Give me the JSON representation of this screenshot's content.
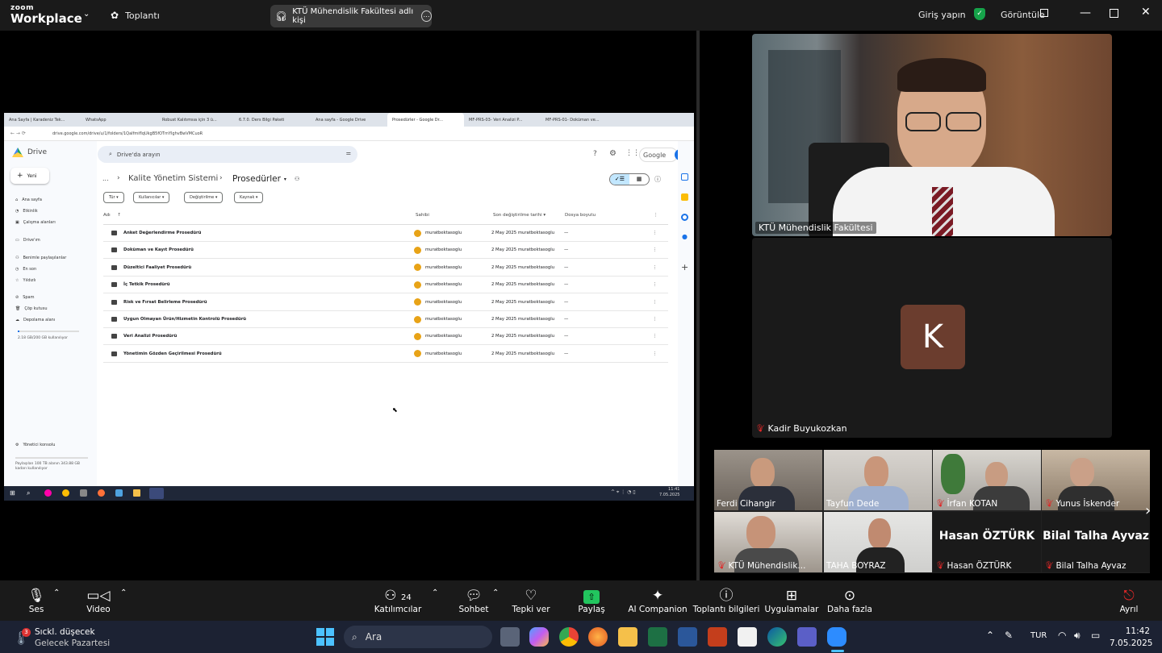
{
  "zoom": {
    "logo_top": "zoom",
    "logo_bottom": "Workplace",
    "meetings_label": "Toplantı",
    "meeting_title": "KTÜ Mühendislik Fakültesi adlı kişi",
    "signin_label": "Giriş yapın",
    "view_label": "Görüntüle"
  },
  "browser": {
    "tabs": [
      "Ana Sayfa | Karadeniz Tek...",
      "WhatsApp",
      "Robust Kalıtımsıa için 3 ü...",
      "6.7.0. Ders Bilgi Paketi",
      "Ana sayfa - Google Drive",
      "Prosedürler - Google Dr...",
      "MF-PRS-03- Veri Analizi P...",
      "MF-PRS-01- Doküman ve..."
    ],
    "url": "drive.google.com/drive/u/1/folders/1QaIfmiflqUkgB5fOTmYlghvBwVMCuoR"
  },
  "drive": {
    "app_name": "Drive",
    "new_label": "Yeni",
    "search_placeholder": "Drive'da arayın",
    "google_label": "Google",
    "user_initial": "V",
    "sidebar": [
      "Ana sayfa",
      "Etkinlik",
      "Çalışma alanları",
      "Drive'ım",
      "Benimle paylaşılanlar",
      "En son",
      "Yıldızlı",
      "Spam",
      "Çöp kutusu",
      "Depolama alanı"
    ],
    "storage_text": "2.18 GB/200 GB kullanılıyor",
    "admin_label": "Yönetici konsolu",
    "storage_footer": "Paylaşılan 100 TB alanın 343.88 GB kadarı kullanılıyor",
    "breadcrumb_dots": "...",
    "breadcrumb_parent": "Kalite Yönetim Sistemi",
    "breadcrumb_current": "Prosedürler",
    "filters": [
      "Tür",
      "Kullanıcılar",
      "Değiştirilme",
      "Kaynak"
    ],
    "columns": {
      "name": "Adı",
      "owner": "Sahibi",
      "modified": "Son değiştirilme tarihi",
      "size": "Dosya boyutu"
    },
    "files": [
      {
        "name": "Anket Değerlendirme Prosedürü",
        "owner": "muratbektasoglu",
        "modified": "2 May 2025 muratbektasoglu",
        "size": "—"
      },
      {
        "name": "Doküman ve Kayıt Prosedürü",
        "owner": "muratbektasoglu",
        "modified": "2 May 2025 muratbektasoglu",
        "size": "—"
      },
      {
        "name": "Düzeltici Faaliyet Prosedürü",
        "owner": "muratbektasoglu",
        "modified": "2 May 2025 muratbektasoglu",
        "size": "—"
      },
      {
        "name": "İç Tetkik Prosedürü",
        "owner": "muratbektasoglu",
        "modified": "2 May 2025 muratbektasoglu",
        "size": "—"
      },
      {
        "name": "Risk ve Fırsat Belirleme Prosedürü",
        "owner": "muratbektasoglu",
        "modified": "2 May 2025 muratbektasoglu",
        "size": "—"
      },
      {
        "name": "Uygun Olmayan Ürün/Hizmetin Kontrolü Prosedürü",
        "owner": "muratbektasoglu",
        "modified": "2 May 2025 muratbektasoglu",
        "size": "—"
      },
      {
        "name": "Veri Analizi Prosedürü",
        "owner": "muratbektasoglu",
        "modified": "2 May 2025 muratbektasoglu",
        "size": "—"
      },
      {
        "name": "Yönetimin Gözden Geçirilmesi Prosedürü",
        "owner": "muratbektasoglu",
        "modified": "2 May 2025 muratbektasoglu",
        "size": "—"
      }
    ]
  },
  "shared_taskbar": {
    "time": "11:41",
    "date": "7.05.2025"
  },
  "participants": {
    "speaker_name": "KTÜ Mühendislik Fakültesi",
    "second_name": "Kadir Buyukozkan",
    "second_initial": "K",
    "gallery": [
      {
        "name": "Ferdi Cihangir"
      },
      {
        "name": "Tayfun Dede"
      },
      {
        "name": "İrfan KOTAN"
      },
      {
        "name": "Yunus İskender"
      },
      {
        "name": "KTÜ Mühendislik..."
      },
      {
        "name": "TAHA BOYRAZ"
      },
      {
        "name": "Hasan ÖZTÜRK",
        "big": "Hasan ÖZTÜRK"
      },
      {
        "name": "Bilal Talha Ayvaz",
        "big": "Bilal Talha Ayvaz"
      }
    ]
  },
  "toolbar": {
    "audio": "Ses",
    "video": "Video",
    "participants": "Katılımcılar",
    "participants_count": "24",
    "chat": "Sohbet",
    "reactions": "Tepki ver",
    "share": "Paylaş",
    "ai": "AI Companion",
    "info": "Toplantı bilgileri",
    "apps": "Uygulamalar",
    "more": "Daha fazla",
    "leave": "Ayrıl"
  },
  "windows": {
    "weather_badge": "3",
    "weather_title": "Sıckl. düşecek",
    "weather_sub": "Gelecek Pazartesi",
    "search": "Ara",
    "lang": "TUR",
    "time": "11:42",
    "date": "7.05.2025"
  }
}
